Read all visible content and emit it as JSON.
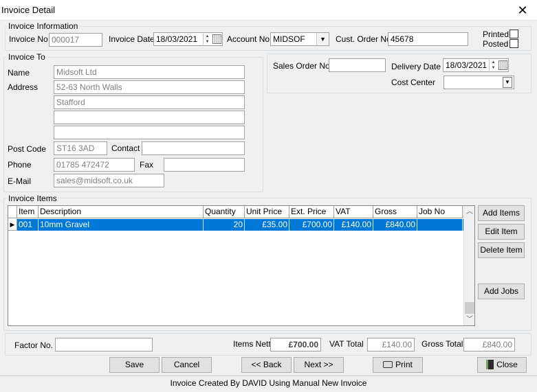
{
  "window": {
    "title": "Invoice Detail",
    "close_glyph": "✕"
  },
  "invoice_info": {
    "legend": "Invoice Information",
    "invoice_no_label": "Invoice No",
    "invoice_no": "000017",
    "invoice_date_label": "Invoice Date",
    "invoice_date": "18/03/2021",
    "account_no_label": "Account No.",
    "account_no": "MIDSOF",
    "cust_order_label": "Cust. Order No.",
    "cust_order": "45678",
    "printed_label": "Printed",
    "posted_label": "Posted"
  },
  "invoice_to": {
    "legend": "Invoice To",
    "name_label": "Name",
    "name": "Midsoft Ltd",
    "address_label": "Address",
    "address": [
      "52-63 North Walls",
      "Stafford",
      "",
      ""
    ],
    "postcode_label": "Post Code",
    "postcode": "ST16 3AD",
    "contact_label": "Contact",
    "contact": "",
    "phone_label": "Phone",
    "phone": "01785 472472",
    "fax_label": "Fax",
    "fax": "",
    "email_label": "E-Mail",
    "email": "sales@midsoft.co.uk"
  },
  "order": {
    "sales_order_label": "Sales Order No.",
    "sales_order": "",
    "delivery_date_label": "Delivery Date",
    "delivery_date": "18/03/2021",
    "cost_center_label": "Cost Center",
    "cost_center": ""
  },
  "items": {
    "legend": "Invoice Items",
    "columns": [
      "Item",
      "Description",
      "Quantity",
      "Unit Price",
      "Ext. Price",
      "VAT",
      "Gross",
      "Job No"
    ],
    "rows": [
      {
        "item": "001",
        "description": "10mm Gravel",
        "quantity": "20",
        "unit_price": "£35.00",
        "ext_price": "£700.00",
        "vat": "£140.00",
        "gross": "£840.00",
        "job_no": ""
      }
    ],
    "buttons": {
      "add_items": "Add Items",
      "edit_item": "Edit Item",
      "delete_item": "Delete Item",
      "add_jobs": "Add Jobs"
    }
  },
  "totals": {
    "factor_label": "Factor No.",
    "factor": "",
    "items_nett_label": "Items Nett",
    "items_nett": "£700.00",
    "vat_total_label": "VAT Total",
    "vat_total": "£140.00",
    "gross_total_label": "Gross Total",
    "gross_total": "£840.00"
  },
  "actions": {
    "save": "Save",
    "cancel": "Cancel",
    "back": "<< Back",
    "next": "Next >>",
    "print": "Print",
    "close": "Close"
  },
  "status": "Invoice Created By DAVID Using Manual New Invoice",
  "colors": {
    "selection": "#0078d7",
    "window_bg": "#f0f0f0"
  },
  "icons": {
    "printer": "printer-icon",
    "door": "door-exit-icon",
    "row_pointer": "row-pointer-icon"
  }
}
